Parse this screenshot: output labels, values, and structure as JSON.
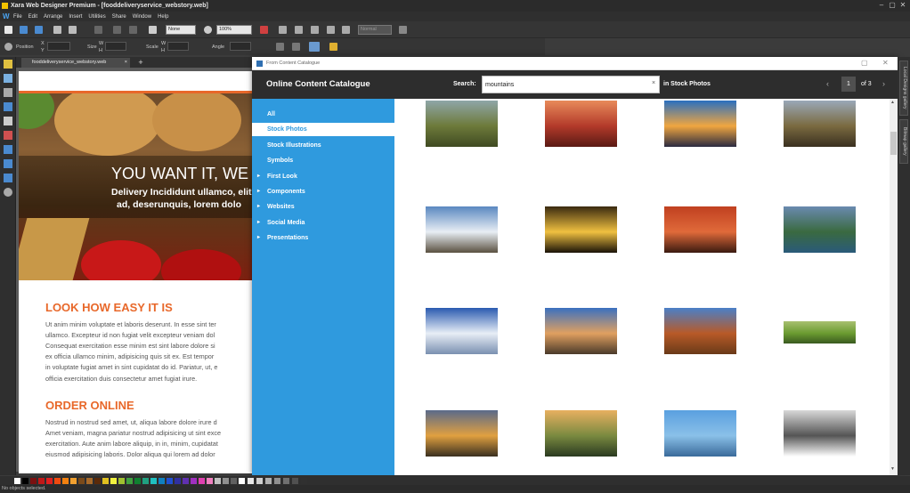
{
  "app": {
    "title": "Xara Web Designer Premium - [fooddeliveryservice_webstory.web]",
    "window_controls": [
      "–",
      "▢",
      "✕"
    ]
  },
  "menu": [
    "File",
    "Edit",
    "Arrange",
    "Insert",
    "Utilities",
    "Share",
    "Window",
    "Help"
  ],
  "toolbar": {
    "quality_combo": "None",
    "zoom_combo": "100%",
    "style_combo": "Normal",
    "labels": {
      "position": "Position",
      "size": "Size",
      "scale": "Scale",
      "angle": "Angle"
    },
    "axis": {
      "x": "X",
      "y": "Y",
      "w": "W",
      "h": "H"
    }
  },
  "document": {
    "tab_label": "fooddeliveryservice_webstory.web",
    "tab_close": "×",
    "tab_add": "+"
  },
  "page": {
    "hero_title": "YOU WANT IT, WE",
    "hero_sub1": "Delivery Incididunt ullamco, elit",
    "hero_sub2": "ad, deserunquis, lorem dolo",
    "section1_heading": "LOOK HOW EASY IT IS",
    "section1_lines": [
      "Ut anim minim voluptate et laboris deserunt. In esse sint ter",
      "ullamco. Excepteur id non fugiat velit excepteur veniam dol",
      "Consequat exercitation esse minim est sint labore dolore si",
      "ex officia ullamco minim, adipisicing quis sit ex. Est tempor",
      "in voluptate fugiat amet in sint cupidatat do id. Pariatur, ut, e",
      "officia exercitation duis consectetur amet fugiat irure."
    ],
    "section2_heading": "ORDER ONLINE",
    "section2_lines": [
      "Nostrud in nostrud sed amet, ut, aliqua labore dolore irure d",
      "Amet veniam, magna pariatur nostrud adipisicing ut sint exce",
      "exercitation. Aute anim labore aliquip, in in, minim, cupidatat",
      "eiusmod adipisicing laboris. Dolor aliqua qui lorem ad dolor"
    ]
  },
  "dialog": {
    "window_title": "From Content Catalogue",
    "heading": "Online Content Catalogue",
    "search_label": "Search:",
    "search_value": "mountains",
    "search_clear": "×",
    "scope": "in Stock Photos",
    "page_current": "1",
    "page_total": "of 3",
    "prev": "‹",
    "next": "›",
    "controls": [
      "▢",
      "✕"
    ],
    "categories": [
      {
        "label": "All",
        "expandable": false,
        "selected": false
      },
      {
        "label": "Stock Photos",
        "expandable": false,
        "selected": true
      },
      {
        "label": "Stock Illustrations",
        "expandable": false,
        "selected": false
      },
      {
        "label": "Symbols",
        "expandable": false,
        "selected": false
      },
      {
        "label": "First Look",
        "expandable": true,
        "selected": false
      },
      {
        "label": "Components",
        "expandable": true,
        "selected": false
      },
      {
        "label": "Websites",
        "expandable": true,
        "selected": false
      },
      {
        "label": "Social Media",
        "expandable": true,
        "selected": false
      },
      {
        "label": "Presentations",
        "expandable": true,
        "selected": false
      }
    ],
    "thumbnails": [
      {
        "name": "hiker-on-trail-thumb",
        "colors": [
          "#8fa6a8",
          "#6d7a3a",
          "#3f4a22"
        ]
      },
      {
        "name": "red-sunset-range-thumb",
        "colors": [
          "#e88a5a",
          "#b33a2a",
          "#5a1a14"
        ]
      },
      {
        "name": "volcano-cone-thumb",
        "colors": [
          "#2a6fc0",
          "#f0a640",
          "#2a2a40"
        ]
      },
      {
        "name": "rocky-highland-thumb",
        "colors": [
          "#9aa8b8",
          "#7a6a40",
          "#3a3020"
        ]
      },
      {
        "name": "peak-summit-thumb",
        "colors": [
          "#5a88c0",
          "#e8eef4",
          "#5a5040"
        ]
      },
      {
        "name": "tree-sunset-thumb",
        "colors": [
          "#3a2a10",
          "#f0c040",
          "#1a1208"
        ]
      },
      {
        "name": "red-sky-mountain-thumb",
        "colors": [
          "#c04020",
          "#e06a3a",
          "#3a1a10"
        ]
      },
      {
        "name": "alpine-lake-thumb",
        "colors": [
          "#6a8ab0",
          "#3a6a40",
          "#2a5a7a"
        ]
      },
      {
        "name": "snowy-ridge-thumb",
        "colors": [
          "#2a5ab0",
          "#e8eef6",
          "#7a90b0"
        ]
      },
      {
        "name": "cairn-stones-thumb",
        "colors": [
          "#3a70c0",
          "#e0a060",
          "#4a3a2a"
        ]
      },
      {
        "name": "desert-butte-thumb",
        "colors": [
          "#4a80c8",
          "#b85a28",
          "#6a3a18"
        ]
      },
      {
        "name": "green-meadow-thumb",
        "colors": [
          "#a8c070",
          "#6a9a30",
          "#3a5a20"
        ]
      },
      {
        "name": "golden-hills-thumb",
        "colors": [
          "#5a6a8a",
          "#e0a040",
          "#3a3020"
        ]
      },
      {
        "name": "misty-valley-thumb",
        "colors": [
          "#e8b060",
          "#7a8a40",
          "#2a3a20"
        ]
      },
      {
        "name": "lake-reflection-thumb",
        "colors": [
          "#5aa0e0",
          "#8ac0e8",
          "#3a6a9a"
        ]
      },
      {
        "name": "matterhorn-bw-thumb",
        "colors": [
          "#d8d8d8",
          "#555555",
          "#ffffff"
        ]
      }
    ]
  },
  "right_tabs": [
    "Local Designs gallery",
    "Bitmap gallery"
  ],
  "palette": [
    "#ffffff",
    "#000000",
    "#7a1010",
    "#c01818",
    "#e02020",
    "#f04a10",
    "#f08010",
    "#f0a030",
    "#7a4a1a",
    "#a86a2a",
    "#5a2a0a",
    "#e0c020",
    "#f0f040",
    "#a0c030",
    "#40a040",
    "#108030",
    "#20a080",
    "#20c0c0",
    "#1080c0",
    "#2050d0",
    "#3030a0",
    "#6030b0",
    "#a030c0",
    "#e040b0",
    "#f080c0",
    "#c0c0c0",
    "#909090",
    "#606060",
    "#ffffff",
    "#e8e8e8",
    "#d0d0d0",
    "#b0b0b0",
    "#909090",
    "#707070",
    "#505050",
    "#303030"
  ],
  "status": "No objects selected."
}
